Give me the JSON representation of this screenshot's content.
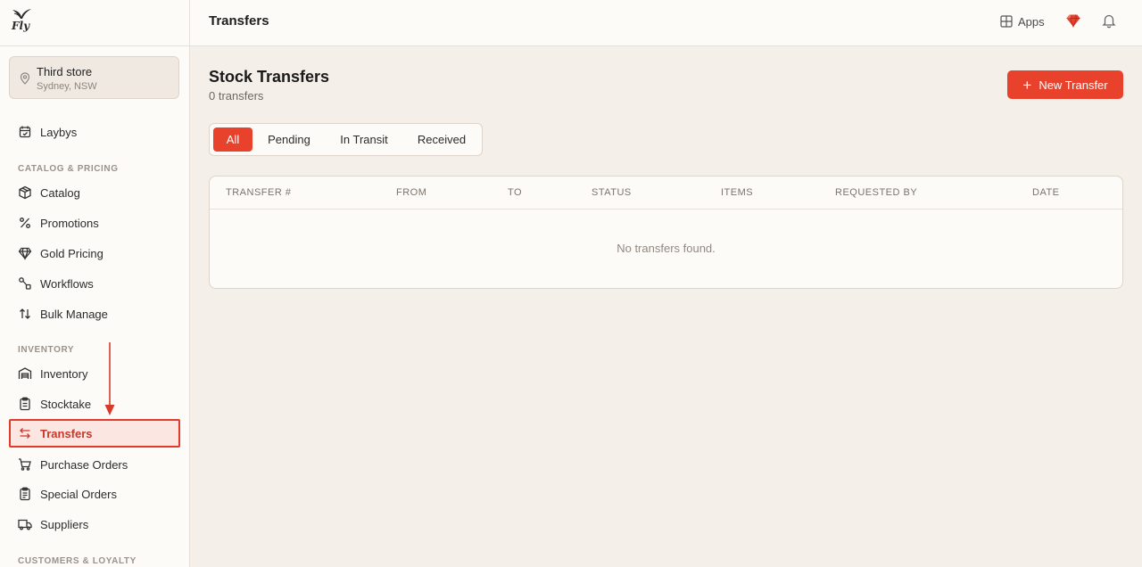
{
  "brand": {
    "logo_text": "Fly"
  },
  "store": {
    "name": "Third store",
    "location": "Sydney, NSW"
  },
  "sidebar": {
    "top_items": [
      {
        "label": "Laybys",
        "icon": "calendar-check-icon"
      }
    ],
    "sections": [
      {
        "label": "CATALOG & PRICING",
        "items": [
          {
            "label": "Catalog",
            "icon": "package-icon"
          },
          {
            "label": "Promotions",
            "icon": "percent-icon"
          },
          {
            "label": "Gold Pricing",
            "icon": "diamond-icon"
          },
          {
            "label": "Workflows",
            "icon": "workflow-icon"
          },
          {
            "label": "Bulk Manage",
            "icon": "arrows-up-down-icon"
          }
        ]
      },
      {
        "label": "INVENTORY",
        "items": [
          {
            "label": "Inventory",
            "icon": "warehouse-icon"
          },
          {
            "label": "Stocktake",
            "icon": "clipboard-icon"
          },
          {
            "label": "Transfers",
            "icon": "transfer-arrows-icon",
            "active": true
          },
          {
            "label": "Purchase Orders",
            "icon": "cart-icon"
          },
          {
            "label": "Special Orders",
            "icon": "clipboard-list-icon"
          },
          {
            "label": "Suppliers",
            "icon": "truck-icon"
          }
        ]
      },
      {
        "label": "CUSTOMERS & LOYALTY",
        "items": []
      }
    ]
  },
  "header": {
    "title": "Transfers",
    "apps_label": "Apps"
  },
  "main": {
    "title": "Stock Transfers",
    "subtitle": "0 transfers",
    "new_button_label": "New Transfer",
    "tabs": [
      {
        "label": "All",
        "active": true
      },
      {
        "label": "Pending"
      },
      {
        "label": "In Transit"
      },
      {
        "label": "Received"
      }
    ],
    "table": {
      "columns": [
        "TRANSFER #",
        "FROM",
        "TO",
        "STATUS",
        "ITEMS",
        "REQUESTED BY",
        "DATE"
      ],
      "empty_message": "No transfers found."
    }
  },
  "colors": {
    "accent": "#e8422d",
    "background": "#f5efe9",
    "surface": "#fdfbf8"
  }
}
